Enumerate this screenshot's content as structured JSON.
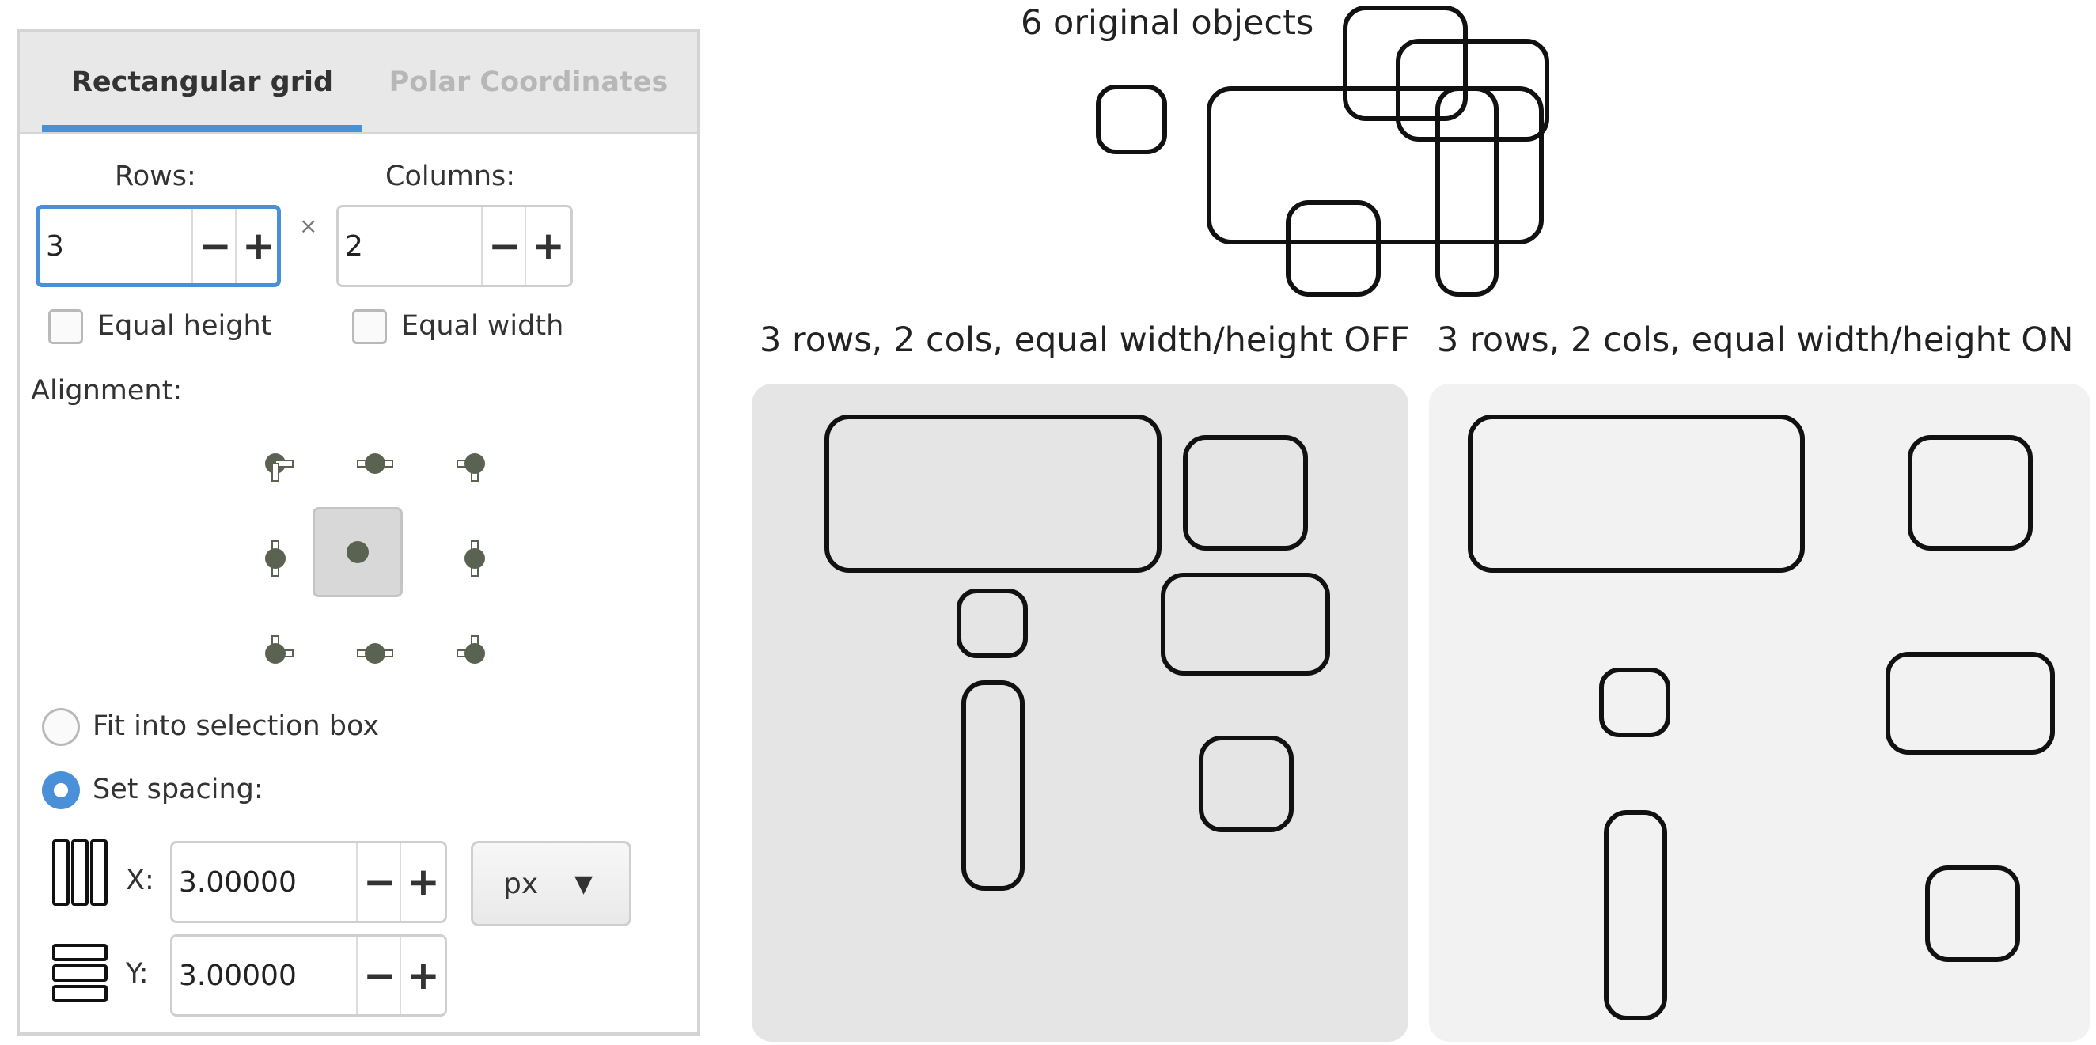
{
  "dialog": {
    "tabs": [
      {
        "label": "Rectangular grid",
        "active": true
      },
      {
        "label": "Polar Coordinates",
        "active": false
      }
    ],
    "rows_label": "Rows:",
    "rows_value": "3",
    "columns_label": "Columns:",
    "columns_value": "2",
    "times_sign": "×",
    "minus": "−",
    "plus": "+",
    "equal_height": {
      "label": "Equal height",
      "checked": false
    },
    "equal_width": {
      "label": "Equal width",
      "checked": false
    },
    "alignment_label": "Alignment:",
    "alignment_selected": "center",
    "fit_selection": {
      "label": "Fit into selection box",
      "selected": false
    },
    "set_spacing": {
      "label": "Set spacing:",
      "selected": true
    },
    "x_label": "X:",
    "x_value": "3.00000",
    "y_label": "Y:",
    "y_value": "3.00000",
    "unit": "px",
    "unit_arrow": "▼",
    "accent_color": "#4a90d9"
  },
  "illustration": {
    "original_caption": "6 original objects",
    "off_caption": "3 rows, 2 cols, equal width/height OFF",
    "on_caption": "3 rows, 2 cols, equal width/height ON",
    "off_background": "#e5e5e5",
    "on_background": "#f2f2f2"
  }
}
